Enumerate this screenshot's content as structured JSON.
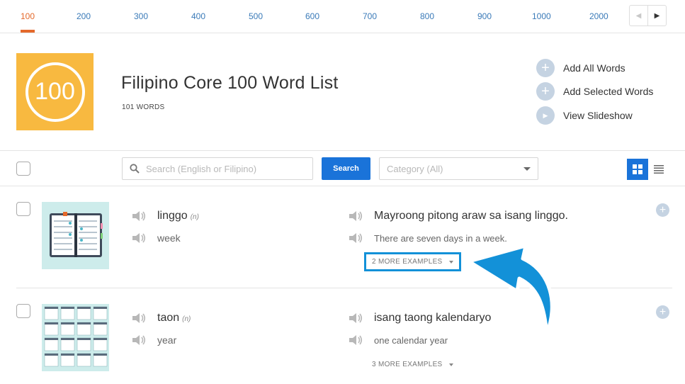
{
  "levels": [
    "100",
    "200",
    "300",
    "400",
    "500",
    "600",
    "700",
    "800",
    "900",
    "1000",
    "2000"
  ],
  "active_level": "100",
  "pager": {
    "prev": "◀",
    "next": "▶"
  },
  "header": {
    "badge": "100",
    "title": "Filipino Core 100 Word List",
    "word_count": "101 WORDS"
  },
  "actions": [
    {
      "icon": "plus-icon",
      "label": "Add All Words"
    },
    {
      "icon": "plus-icon",
      "label": "Add Selected Words"
    },
    {
      "icon": "play-icon",
      "label": "View Slideshow"
    }
  ],
  "toolbar": {
    "search_placeholder": "Search (English or Filipino)",
    "search_button": "Search",
    "category": "Category (All)"
  },
  "words": [
    {
      "word": "linggo",
      "pos": "(n)",
      "gloss": "week",
      "example": "Mayroong pitong araw sa isang linggo.",
      "translation": "There are seven days in a week.",
      "more": "2 MORE EXAMPLES",
      "thumb": "planner-icon"
    },
    {
      "word": "taon",
      "pos": "(n)",
      "gloss": "year",
      "example": "isang taong kalendaryo",
      "translation": "one calendar year",
      "more": "3 MORE EXAMPLES",
      "thumb": "calendar-grid-icon"
    }
  ],
  "colors": {
    "accent": "#e4692b",
    "primary": "#1a73d9",
    "badge": "#f8b940",
    "highlight": "#1391d8"
  }
}
